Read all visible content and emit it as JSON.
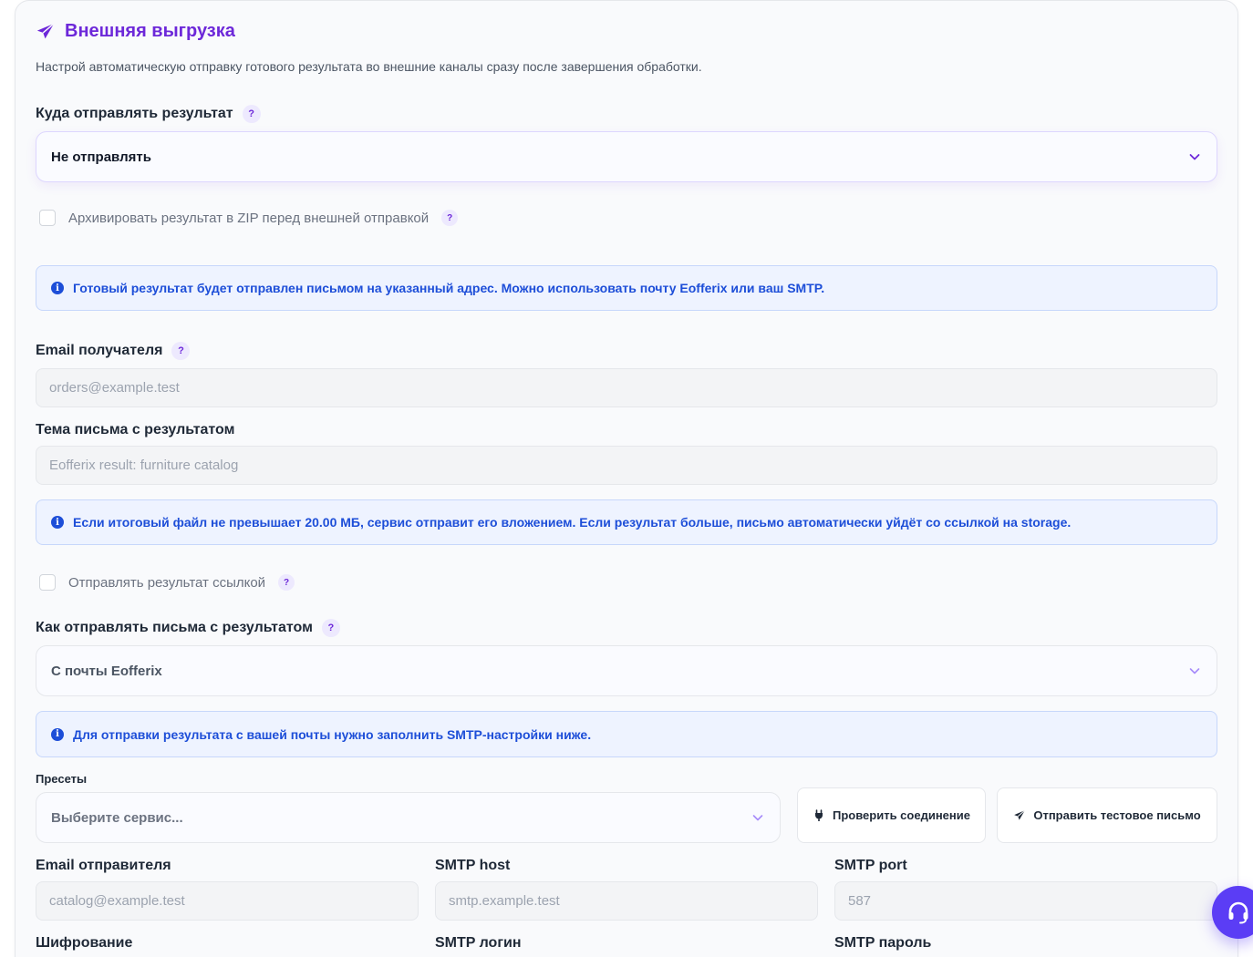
{
  "section": {
    "title": "Внешняя выгрузка",
    "description": "Настрой автоматическую отправку готового результата во внешние каналы сразу после завершения обработки."
  },
  "destination": {
    "label": "Куда отправлять результат",
    "help": "?",
    "value": "Не отправлять"
  },
  "zip_checkbox": {
    "label": "Архивировать результат в ZIP перед внешней отправкой",
    "help": "?",
    "checked": false
  },
  "email_info": "Готовый результат будет отправлен письмом на указанный адрес. Можно использовать почту Eofferix или ваш SMTP.",
  "recipient": {
    "label": "Email получателя",
    "help": "?",
    "placeholder": "orders@example.test"
  },
  "subject": {
    "label": "Тема письма с результатом",
    "placeholder": "Eofferix result: furniture catalog"
  },
  "size_info": "Если итоговый файл не превышает 20.00 МБ, сервис отправит его вложением. Если результат больше, письмо автоматически уйдёт со ссылкой на storage.",
  "link_checkbox": {
    "label": "Отправлять результат ссылкой",
    "help": "?",
    "checked": false
  },
  "send_method": {
    "label": "Как отправлять письма с результатом",
    "help": "?",
    "value": "С почты Eofferix"
  },
  "smtp_info": "Для отправки результата с вашей почты нужно заполнить SMTP-настройки ниже.",
  "presets": {
    "label": "Пресеты",
    "placeholder": "Выберите сервис..."
  },
  "buttons": {
    "check_connection": "Проверить соединение",
    "send_test": "Отправить тестовое письмо"
  },
  "smtp": {
    "sender_label": "Email отправителя",
    "sender_placeholder": "catalog@example.test",
    "host_label": "SMTP host",
    "host_placeholder": "smtp.example.test",
    "port_label": "SMTP port",
    "port_placeholder": "587",
    "encryption_label": "Шифрование",
    "login_label": "SMTP логин",
    "password_label": "SMTP пароль"
  },
  "icons": {
    "title": "paper-plane-icon",
    "chevron": "chevron-down-icon",
    "info": "info-icon",
    "plug": "plug-icon",
    "send": "paper-plane-icon",
    "support": "headset-icon"
  },
  "colors": {
    "accent": "#6d28d9",
    "info_text": "#1d4ed8",
    "info_bg": "#eef3ff",
    "support_button": "#5b3df5"
  }
}
